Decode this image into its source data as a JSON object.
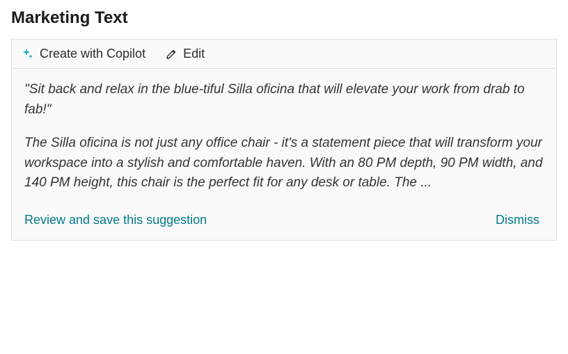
{
  "section": {
    "title": "Marketing Text"
  },
  "toolbar": {
    "create_label": "Create with Copilot",
    "edit_label": "Edit"
  },
  "suggestion": {
    "quote": "\"Sit back and relax in the blue-tiful Silla oficina that will elevate your work from drab to fab!\"",
    "body": "The Silla oficina is not just any office chair - it's a statement piece  that will transform your workspace into a stylish and comfortable haven. With an 80 PM depth, 90 PM width, and 140 PM height, this chair is the perfect fit for any desk or table. The ...",
    "review_label": "Review and save this suggestion",
    "dismiss_label": "Dismiss"
  },
  "colors": {
    "accent": "#007a8a",
    "text": "#333333",
    "border": "#e0e0e0"
  }
}
